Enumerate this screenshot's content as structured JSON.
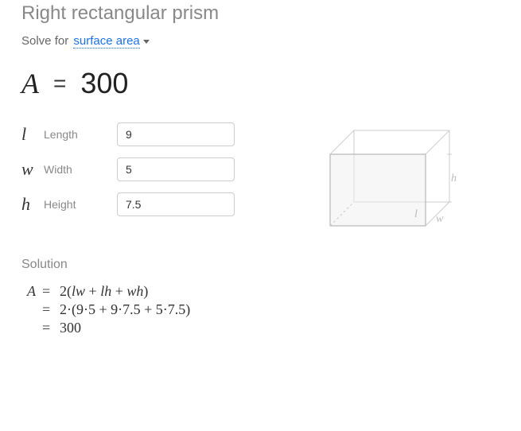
{
  "header": {
    "title": "Right rectangular prism",
    "solve_for_label": "Solve for",
    "solve_for_value": "surface area"
  },
  "result": {
    "var_symbol": "A",
    "equals": "=",
    "value": "300"
  },
  "inputs": [
    {
      "sym": "l",
      "label": "Length",
      "value": "9"
    },
    {
      "sym": "w",
      "label": "Width",
      "value": "5"
    },
    {
      "sym": "h",
      "label": "Height",
      "value": "7.5"
    }
  ],
  "diagram": {
    "l": "l",
    "w": "w",
    "h": "h"
  },
  "solution": {
    "title": "Solution",
    "lines": [
      {
        "lhs": "A",
        "eq": "=",
        "rhs_html": "2(lw + lh + wh)",
        "parts": [
          "2(",
          "l",
          "w",
          " + ",
          "l",
          "h",
          " + ",
          "w",
          "h",
          ")"
        ]
      },
      {
        "lhs": "",
        "eq": "=",
        "rhs_html": "2·(9·5 + 9·7.5 + 5·7.5)"
      },
      {
        "lhs": "",
        "eq": "=",
        "rhs_html": "300"
      }
    ]
  },
  "chart_data": {
    "type": "table",
    "title": "Right rectangular prism — surface area",
    "variables": [
      {
        "symbol": "l",
        "name": "Length",
        "value": 9
      },
      {
        "symbol": "w",
        "name": "Width",
        "value": 5
      },
      {
        "symbol": "h",
        "name": "Height",
        "value": 7.5
      }
    ],
    "formula": "A = 2(lw + lh + wh)",
    "result": {
      "symbol": "A",
      "value": 300
    }
  }
}
